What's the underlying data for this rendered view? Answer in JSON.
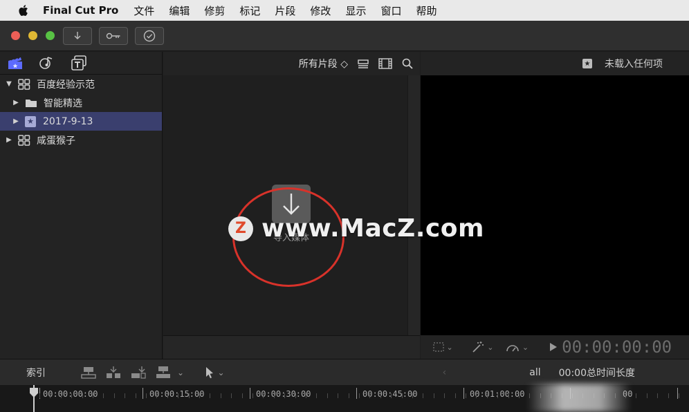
{
  "menubar": {
    "app_name": "Final Cut Pro",
    "items": [
      "文件",
      "编辑",
      "修剪",
      "标记",
      "片段",
      "修改",
      "显示",
      "窗口",
      "帮助"
    ]
  },
  "toolbar": {
    "buttons": [
      "import-icon",
      "key-icon",
      "checkmark-icon"
    ],
    "traffic_colors": [
      "#ec5f57",
      "#e0b834",
      "#58c244"
    ]
  },
  "library": {
    "items": [
      {
        "label": "百度经验示范",
        "icon": "library-icon",
        "level": 0,
        "expanded": true
      },
      {
        "label": "智能精选",
        "icon": "folder-icon",
        "level": 1,
        "expanded": false
      },
      {
        "label": "2017-9-13",
        "icon": "star-event-icon",
        "level": 1,
        "expanded": false,
        "selected": true
      },
      {
        "label": "咸蛋猴子",
        "icon": "library-icon",
        "level": 0,
        "expanded": false
      }
    ]
  },
  "browser": {
    "filter_label": "所有片段 ◇",
    "import_label": "导入媒体"
  },
  "viewer": {
    "status": "未载入任何项",
    "timecode": "00:00:00:00"
  },
  "timeline": {
    "index_label": "索引",
    "right_label_all": "all",
    "right_label_duration": "00:00总时间长度",
    "ruler_labels": [
      "00:00:00:00",
      "00:00:15:00",
      "00:00:30:00",
      "00:00:45:00",
      "00:01:00:00",
      "00"
    ]
  },
  "watermark": {
    "badge": "Z",
    "text": "www.MacZ.com"
  },
  "colors": {
    "selection": "#3a3f6e",
    "annotation_red": "#d8322a"
  }
}
